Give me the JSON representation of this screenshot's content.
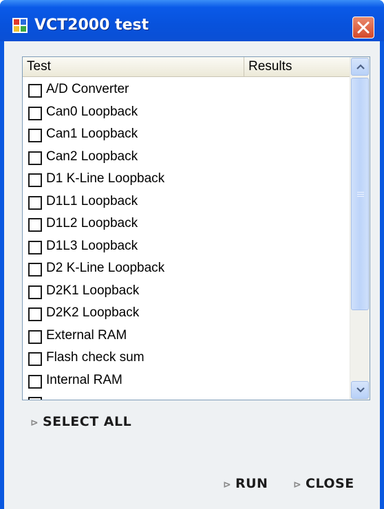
{
  "window": {
    "title": "VCT2000 test"
  },
  "list": {
    "columns": [
      "Test",
      "Results"
    ],
    "items": [
      {
        "label": "A/D Converter",
        "checked": false
      },
      {
        "label": "Can0 Loopback",
        "checked": false
      },
      {
        "label": "Can1 Loopback",
        "checked": false
      },
      {
        "label": "Can2 Loopback",
        "checked": false
      },
      {
        "label": "D1 K-Line Loopback",
        "checked": false
      },
      {
        "label": "D1L1 Loopback",
        "checked": false
      },
      {
        "label": "D1L2 Loopback",
        "checked": false
      },
      {
        "label": "D1L3 Loopback",
        "checked": false
      },
      {
        "label": "D2 K-Line Loopback",
        "checked": false
      },
      {
        "label": "D2K1 Loopback",
        "checked": false
      },
      {
        "label": "D2K2 Loopback",
        "checked": false
      },
      {
        "label": "External RAM",
        "checked": false
      },
      {
        "label": "Flash check sum",
        "checked": false
      },
      {
        "label": "Internal RAM",
        "checked": false
      }
    ]
  },
  "buttons": {
    "select_all": "SELECT ALL",
    "run": "RUN",
    "close": "CLOSE"
  },
  "icons": {
    "app": "app-window-icon",
    "close": "close-x-icon",
    "scroll_up": "chevron-up-icon",
    "scroll_down": "chevron-down-icon",
    "command": "arrow-right-icon"
  },
  "colors": {
    "titlebar": "#0a58e0",
    "close_button": "#d4492a",
    "client_background": "#eef1f3",
    "scrollbar": "#bdd4f9"
  }
}
